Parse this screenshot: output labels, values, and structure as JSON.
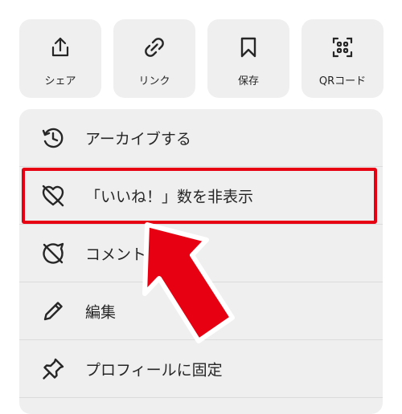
{
  "share_actions": [
    {
      "label": "シェア",
      "icon": "share-icon"
    },
    {
      "label": "リンク",
      "icon": "link-icon"
    },
    {
      "label": "保存",
      "icon": "bookmark-icon"
    },
    {
      "label": "QRコード",
      "icon": "qr-code-icon"
    }
  ],
  "menu_items": [
    {
      "label": "アーカイブする",
      "icon": "archive-history-icon"
    },
    {
      "label": "「いいね！」数を非表示",
      "icon": "heart-off-icon"
    },
    {
      "label": "コメント",
      "icon": "comment-off-icon"
    },
    {
      "label": "編集",
      "icon": "pencil-icon"
    },
    {
      "label": "プロフィールに固定",
      "icon": "pin-icon"
    }
  ],
  "annotation": {
    "highlight_color": "#e60012",
    "arrow_color": "#e60012",
    "highlighted_item": "「いいね！」数を非表示"
  }
}
